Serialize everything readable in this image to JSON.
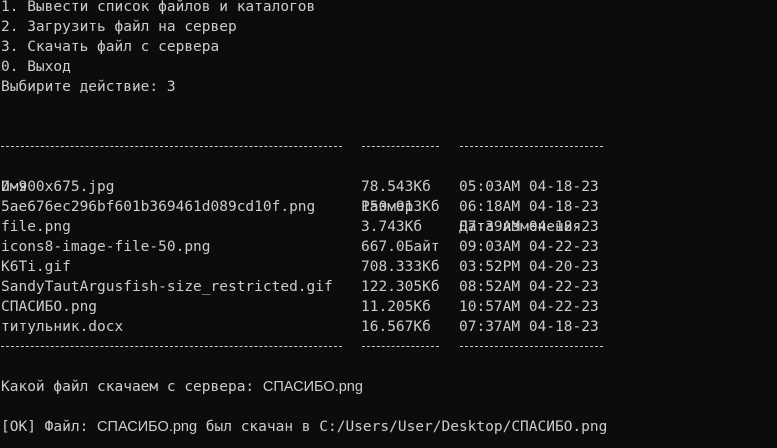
{
  "menu": {
    "items": [
      "1. Вывести список файлов и каталогов",
      "2. Загрузить файл на сервер",
      "3. Скачать файл с сервера",
      "0. Выход"
    ],
    "prompt": "Выбирите действие: ",
    "choice": "3"
  },
  "table": {
    "headers": [
      "Имя",
      "Размер",
      "Дата изменения"
    ],
    "rows": [
      [
        "0-900x675.jpg",
        "78.543Кб",
        "05:03AM 04-18-23"
      ],
      [
        "5ae676ec296bf601b369461d089cd10f.png",
        "150.913Кб",
        "06:18AM 04-18-23"
      ],
      [
        "file.png",
        "3.743Кб",
        "07:39AM 04-18-23"
      ],
      [
        "icons8-image-file-50.png",
        "667.0Байт",
        "09:03AM 04-22-23"
      ],
      [
        "K6Ti.gif",
        "708.333Кб",
        "03:52PM 04-20-23"
      ],
      [
        "SandyTautArgusfish-size_restricted.gif",
        "122.305Кб",
        "08:52AM 04-22-23"
      ],
      [
        "СПАСИБО.png",
        "11.205Кб",
        "10:57AM 04-22-23"
      ],
      [
        "титульник.docx",
        "16.567Кб",
        "07:37AM 04-18-23"
      ]
    ]
  },
  "download": {
    "prompt": "Какой файл скачаем с сервера: ",
    "filename": "СПАСИБО.png"
  },
  "result": {
    "status": "[OK] Файл:",
    "filename": "СПАСИБО.png",
    "message": "был скачан в C:/Users/User/Desktop/СПАСИБО.png"
  },
  "colors": {
    "background": "#0c0c0c",
    "foreground": "#cccccc"
  }
}
